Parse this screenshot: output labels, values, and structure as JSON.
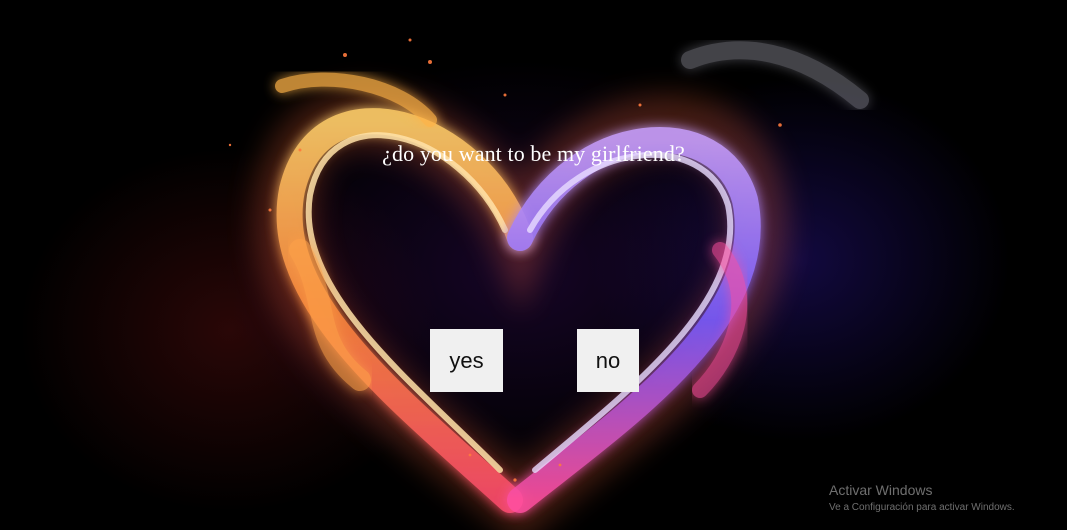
{
  "page": {
    "question": "¿do you want to be my girlfriend?",
    "yes_label": "yes",
    "no_label": "no",
    "background_image": "flaming-heart"
  },
  "watermark": {
    "title": "Activar Windows",
    "subtitle": "Ve a Configuración para activar Windows."
  },
  "colors": {
    "background": "#000000",
    "button_bg": "#f0f0f0",
    "text": "#ffffff",
    "flame_orange": "#ffb347",
    "flame_blue": "#6a5cff",
    "flame_pink": "#ff4fa0"
  }
}
